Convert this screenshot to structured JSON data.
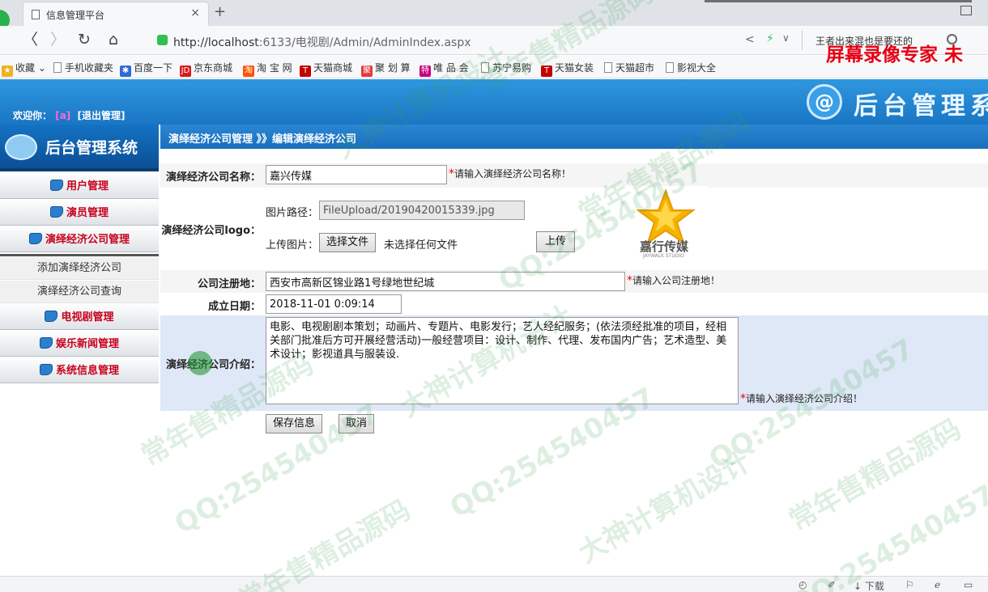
{
  "browser": {
    "tab_title": "信息管理平台",
    "tab_close": "×",
    "new_tab": "+",
    "url_scheme_host": "http://localhost",
    "url_rest": ":6133/电视剧/Admin/AdminIndex.aspx",
    "search_text": "王者出来混也是要还的",
    "bookmarks": [
      {
        "label": "收藏",
        "color": "#f2b01e"
      },
      {
        "label": "手机收藏夹",
        "color": ""
      },
      {
        "label": "百度一下",
        "color": "#2f6bd8"
      },
      {
        "label": "京东商城",
        "color": "#d71a1a",
        "mark": "JD"
      },
      {
        "label": "淘 宝 网",
        "color": "#ff5000",
        "mark": "淘"
      },
      {
        "label": "天猫商城",
        "color": "#c40000",
        "mark": "T"
      },
      {
        "label": "聚 划 算",
        "color": "#e4393c",
        "mark": "聚"
      },
      {
        "label": "唯 品 会",
        "color": "#c6047e",
        "mark": "特"
      },
      {
        "label": "苏宁易购",
        "color": ""
      },
      {
        "label": "天猫女装",
        "color": "#c40000",
        "mark": "T"
      },
      {
        "label": "天猫超市",
        "color": ""
      },
      {
        "label": "影视大全",
        "color": ""
      }
    ],
    "recorder_text": "屏幕录像专家  未",
    "download_label": "下载"
  },
  "header": {
    "welcome_label": "欢迎你：",
    "user": "[a]",
    "logout": "[退出管理]",
    "logo_mark": "@",
    "title": "后台管理系"
  },
  "sidebar": {
    "logo_title": "后台管理系统",
    "menus": [
      {
        "label": "用户管理"
      },
      {
        "label": "演员管理"
      },
      {
        "label": "演绎经济公司管理"
      }
    ],
    "submenus": [
      {
        "label": "添加演绎经济公司"
      },
      {
        "label": "演绎经济公司查询"
      }
    ],
    "menus2": [
      {
        "label": "电视剧管理"
      },
      {
        "label": "娱乐新闻管理"
      },
      {
        "label": "系统信息管理"
      }
    ]
  },
  "main": {
    "breadcrumb": "演绎经济公司管理 》》编辑演绎经济公司",
    "name_label": "演绎经济公司名称：",
    "name_value": "嘉兴传媒",
    "name_hint": "请输入演绎经济公司名称！",
    "logo_label": "演绎经济公司logo：",
    "path_label": "图片路径：",
    "path_value": "FileUpload/20190420015339.jpg",
    "upload_label": "上传图片：",
    "choose_file": "选择文件",
    "no_file": "未选择任何文件",
    "upload_btn": "上传",
    "logo_caption": "嘉行传媒",
    "logo_sub": "JAYWALK STUDIO",
    "reg_label": "公司注册地：",
    "reg_value": "西安市高新区锦业路1号绿地世纪城",
    "reg_hint": "请输入公司注册地！",
    "date_label": "成立日期：",
    "date_value": "2018-11-01 0:09:14",
    "intro_label": "演绎经济公司介绍：",
    "intro_value": "电影、电视剧剧本策划；动画片、专题片、电影发行；艺人经纪服务；(依法须经批准的项目，经相关部门批准后方可开展经营活动)一般经营项目：设计、制作、代理、发布国内广告；艺术造型、美术设计；影视道具与服装设.",
    "intro_hint": "请输入演绎经济公司介绍！",
    "save_btn": "保存信息",
    "cancel_btn": "取消",
    "required_mark": "*"
  },
  "watermark": {
    "texts": [
      "常年售精品源码",
      "大神计算机设计",
      "QQ:254540457"
    ]
  }
}
